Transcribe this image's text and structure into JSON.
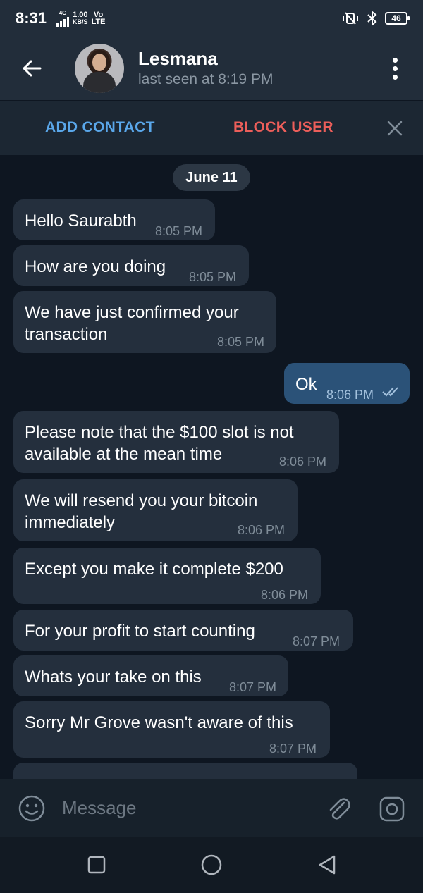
{
  "status_bar": {
    "time": "8:31",
    "net_type": "4G",
    "speed_value": "1.00",
    "speed_unit": "KB/S",
    "carrier": "Vo",
    "carrier_sub": "LTE",
    "battery": "46"
  },
  "header": {
    "name": "Lesmana",
    "status": "last seen at 8:19 PM"
  },
  "action_bar": {
    "add_contact": "ADD CONTACT",
    "block_user": "BLOCK USER"
  },
  "chat": {
    "date": "June 11",
    "messages": [
      {
        "text": "Hello Saurabth",
        "time": "8:05 PM"
      },
      {
        "text": "How are you doing",
        "time": "8:05 PM"
      },
      {
        "line1": "We have just confirmed your",
        "line2": "transaction",
        "time": "8:05 PM"
      },
      {
        "text": "Ok",
        "time": "8:06 PM"
      },
      {
        "line1": "Please note that the $100 slot is not",
        "line2": "available at the mean time",
        "time": "8:06 PM"
      },
      {
        "line1": "We will resend you your bitcoin",
        "line2": "immediately",
        "time": "8:06 PM"
      },
      {
        "text": "Except you make it complete $200",
        "time": "8:06 PM"
      },
      {
        "text": "For your profit to start counting",
        "time": "8:07 PM"
      },
      {
        "text": "Whats your take on this",
        "time": "8:07 PM"
      },
      {
        "text": "Sorry Mr Grove wasn't aware of this",
        "time": "8:07 PM"
      }
    ]
  },
  "input": {
    "placeholder": "Message"
  },
  "colors": {
    "background": "#0e1621",
    "header": "#222d3a",
    "incoming_bubble": "#242f3d",
    "outgoing_bubble": "#2b5278",
    "accent_blue": "#5aa7ea",
    "danger_red": "#ec5e5a"
  }
}
